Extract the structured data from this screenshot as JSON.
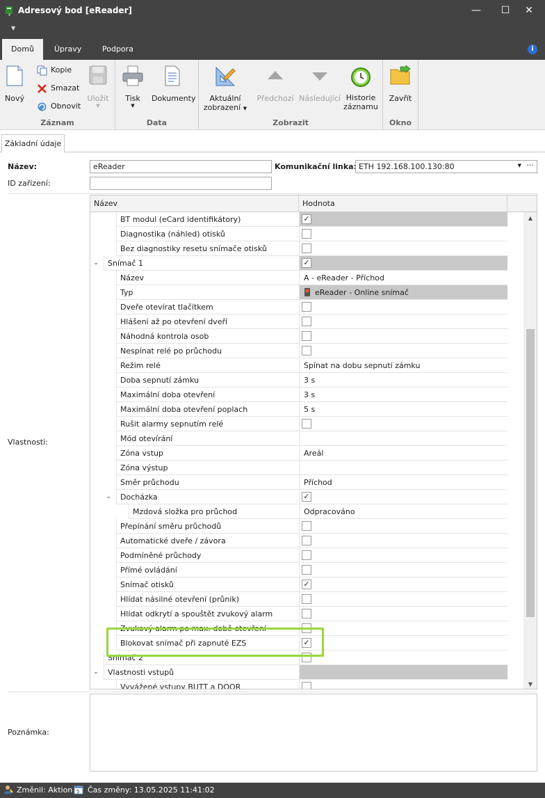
{
  "window": {
    "title": "Adresový bod [eReader]",
    "minimize": "—",
    "maximize": "☐",
    "close": "✕"
  },
  "ribbon_tabs": [
    {
      "label": "Domů",
      "active": true
    },
    {
      "label": "Úpravy",
      "active": false
    },
    {
      "label": "Podpora",
      "active": false
    }
  ],
  "ribbon": {
    "zaznam": {
      "label": "Záznam",
      "novy": "Nový",
      "kopie": "Kopie",
      "smazat": "Smazat",
      "obnovit": "Obnovit",
      "ulozit": "Uložit"
    },
    "data": {
      "label": "Data",
      "tisk": "Tisk",
      "dokumenty": "Dokumenty"
    },
    "zobrazit": {
      "label": "Zobrazit",
      "aktualni_1": "Aktuální",
      "aktualni_2": "zobrazení",
      "predchozi": "Předchozí",
      "nasledujici": "Následující",
      "historie_1": "Historie",
      "historie_2": "záznamu"
    },
    "okno": {
      "label": "Okno",
      "zavrit": "Zavřít"
    }
  },
  "page_tab": "Základní údaje",
  "form": {
    "nazev_label": "Název:",
    "nazev_value": "eReader",
    "linka_label": "Komunikační linka:",
    "linka_value": "ETH 192.168.100.130:80",
    "id_label": "ID zařízení:",
    "id_value": "",
    "vlastnosti_label": "Vlastnosti:",
    "poznamka_label": "Poznámka:"
  },
  "grid": {
    "col_name": "Název",
    "col_value": "Hodnota",
    "rows": [
      {
        "name": "BT modul (eCard identifikátory)",
        "level": 2,
        "kind": "check",
        "checked": true,
        "gray": true
      },
      {
        "name": "Diagnostika (náhled) otisků",
        "level": 2,
        "kind": "check",
        "checked": false
      },
      {
        "name": "Bez diagnostiky resetu snímače otisků",
        "level": 2,
        "kind": "check",
        "checked": false
      },
      {
        "name": "Snímač 1",
        "level": 1,
        "kind": "check",
        "checked": true,
        "gray": true,
        "expander": "⌄"
      },
      {
        "name": "Název",
        "level": 2,
        "kind": "text",
        "value": "A - eReader - Příchod"
      },
      {
        "name": "Typ",
        "level": 2,
        "kind": "type",
        "value": "eReader - Online snímač",
        "gray": true
      },
      {
        "name": "Dveře otevírat tlačítkem",
        "level": 2,
        "kind": "check",
        "checked": false
      },
      {
        "name": "Hlášení až po otevření dveří",
        "level": 2,
        "kind": "check",
        "checked": false
      },
      {
        "name": "Náhodná kontrola osob",
        "level": 2,
        "kind": "check",
        "checked": false
      },
      {
        "name": "Nespínat relé po průchodu",
        "level": 2,
        "kind": "check",
        "checked": false
      },
      {
        "name": "Režim relé",
        "level": 2,
        "kind": "text",
        "value": "Spínat na dobu sepnutí zámku"
      },
      {
        "name": "Doba sepnutí zámku",
        "level": 2,
        "kind": "text",
        "value": "3 s"
      },
      {
        "name": "Maximální doba otevření",
        "level": 2,
        "kind": "text",
        "value": "3 s"
      },
      {
        "name": "Maximální doba otevření poplach",
        "level": 2,
        "kind": "text",
        "value": "5 s"
      },
      {
        "name": "Rušit alarmy sepnutím relé",
        "level": 2,
        "kind": "check",
        "checked": false
      },
      {
        "name": "Mód otevírání",
        "level": 2,
        "kind": "text",
        "value": ""
      },
      {
        "name": "Zóna vstup",
        "level": 2,
        "kind": "text",
        "value": "Areál"
      },
      {
        "name": "Zóna výstup",
        "level": 2,
        "kind": "text",
        "value": ""
      },
      {
        "name": "Směr průchodu",
        "level": 2,
        "kind": "text",
        "value": "Příchod"
      },
      {
        "name": "Docházka",
        "level": 2,
        "kind": "check",
        "checked": true,
        "expander": "⌄"
      },
      {
        "name": "Mzdová složka pro průchod",
        "level": 3,
        "kind": "text",
        "value": "Odpracováno"
      },
      {
        "name": "Přepínání směru průchodů",
        "level": 2,
        "kind": "check",
        "checked": false
      },
      {
        "name": "Automatické dveře / závora",
        "level": 2,
        "kind": "check",
        "checked": false
      },
      {
        "name": "Podmíněné průchody",
        "level": 2,
        "kind": "check",
        "checked": false
      },
      {
        "name": "Přímé ovládání",
        "level": 2,
        "kind": "check",
        "checked": false
      },
      {
        "name": "Snímač otisků",
        "level": 2,
        "kind": "check",
        "checked": true
      },
      {
        "name": "Hlídat násilné otevření (průnik)",
        "level": 2,
        "kind": "check",
        "checked": false
      },
      {
        "name": "Hlídat odkrytí a spouštět zvukový alarm",
        "level": 2,
        "kind": "check",
        "checked": false
      },
      {
        "name": "Zvukový alarm po max. době otevření",
        "level": 2,
        "kind": "check",
        "checked": false
      },
      {
        "name": "Blokovat snímač při zapnuté EZS",
        "level": 2,
        "kind": "check",
        "checked": true
      },
      {
        "name": "Snímač 2",
        "level": 1,
        "kind": "check",
        "checked": false
      },
      {
        "name": "Vlastnosti vstupů",
        "level": 1,
        "kind": "empty",
        "gray": true,
        "expander": "⌄"
      },
      {
        "name": "Vyvážené vstupy BUTT a DOOR",
        "level": 2,
        "kind": "check",
        "checked": false
      }
    ]
  },
  "status": {
    "zmenil": "Změnil: Aktion",
    "cas": "Čas změny: 13.05.2025 11:41:02"
  },
  "colors": {
    "chrome": "#434343",
    "ribbon_bg": "#f0f0f0",
    "highlight": "#9ad73a"
  }
}
